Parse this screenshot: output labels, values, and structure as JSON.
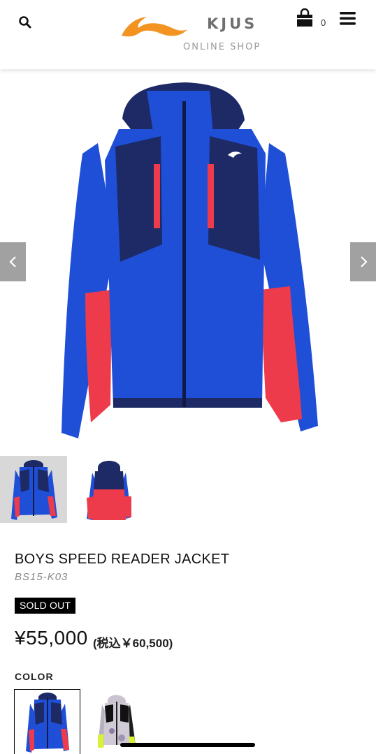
{
  "header": {
    "brand_name": "KJUS",
    "brand_subtitle": "ONLINE SHOP",
    "cart_count": "0",
    "icons": [
      "search-icon",
      "logo-swoosh-icon",
      "shopping-bag-icon",
      "hamburger-menu-icon"
    ],
    "brand_color": "#f39322"
  },
  "gallery": {
    "prev_icon": "chevron-left-icon",
    "next_icon": "chevron-right-icon",
    "thumbnail_count": 2,
    "selected_thumbnail": 1
  },
  "product": {
    "name": "BOYS SPEED READER JACKET",
    "code": "BS15-K03",
    "status_badge": "SOLD OUT",
    "price": "¥55,000",
    "price_with_tax": "(税込￥60,500)"
  },
  "color": {
    "label": "COLOR",
    "swatch_count": 2,
    "selected_swatch": 1
  },
  "colors": {
    "jacket_blue": "#1e4fd6",
    "jacket_navy": "#1d2a66",
    "jacket_red": "#ee3b4b",
    "badge_bg": "#000000"
  }
}
